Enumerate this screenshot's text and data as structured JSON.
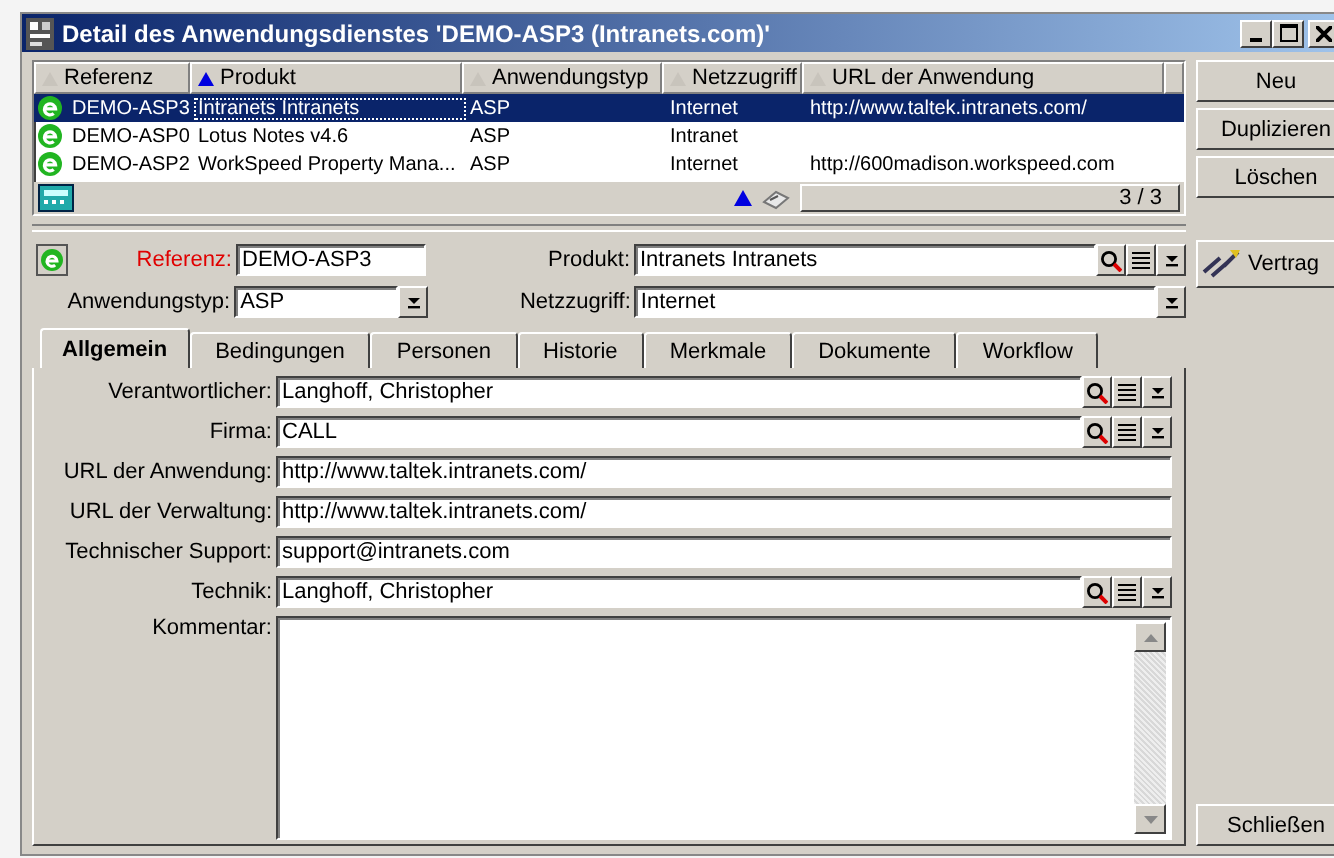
{
  "window": {
    "title": "Detail des Anwendungsdienstes 'DEMO-ASP3 (Intranets.com)'"
  },
  "list": {
    "columns": [
      {
        "label": "Referenz",
        "sorted": false
      },
      {
        "label": "Produkt",
        "sorted": true
      },
      {
        "label": "Anwendungstyp",
        "sorted": false
      },
      {
        "label": "Netzzugriff",
        "sorted": false
      },
      {
        "label": "URL der Anwendung",
        "sorted": false
      }
    ],
    "rows": [
      {
        "cells": [
          "DEMO-ASP3",
          "Intranets Intranets",
          "ASP",
          "Internet",
          "http://www.taltek.intranets.com/"
        ],
        "selected": true
      },
      {
        "cells": [
          "DEMO-ASP0",
          "Lotus Notes v4.6",
          "ASP",
          "Intranet",
          ""
        ],
        "selected": false
      },
      {
        "cells": [
          "DEMO-ASP2",
          "WorkSpeed Property Mana...",
          "ASP",
          "Internet",
          "http://600madison.workspeed.com"
        ],
        "selected": false
      }
    ],
    "counter": "3 / 3"
  },
  "side_buttons": [
    "Neu",
    "Duplizieren",
    "Löschen"
  ],
  "contract_button": "Vertrag",
  "close_button": "Schließen",
  "header": {
    "referenz": {
      "label": "Referenz:",
      "value": "DEMO-ASP3",
      "required": true
    },
    "produkt": {
      "label": "Produkt:",
      "value": "Intranets Intranets"
    },
    "typ": {
      "label": "Anwendungstyp:",
      "value": "ASP"
    },
    "netz": {
      "label": "Netzzugriff:",
      "value": "Internet"
    }
  },
  "tabs": [
    {
      "label": "Allgemein",
      "selected": true
    },
    {
      "label": "Bedingungen",
      "selected": false
    },
    {
      "label": "Personen",
      "selected": false
    },
    {
      "label": "Historie",
      "selected": false
    },
    {
      "label": "Merkmale",
      "selected": false
    },
    {
      "label": "Dokumente",
      "selected": false
    },
    {
      "label": "Workflow",
      "selected": false
    }
  ],
  "fields": [
    {
      "label": "Verantwortlicher:",
      "value": "Langhoff, Christopher",
      "kind": "lookup"
    },
    {
      "label": "Firma:",
      "value": "CALL",
      "kind": "lookup"
    },
    {
      "label": "URL der Anwendung:",
      "value": "http://www.taltek.intranets.com/",
      "kind": "text"
    },
    {
      "label": "URL der Verwaltung:",
      "value": "http://www.taltek.intranets.com/",
      "kind": "text"
    },
    {
      "label": "Technischer Support:",
      "value": "support@intranets.com",
      "kind": "text"
    },
    {
      "label": "Technik:",
      "value": "Langhoff, Christopher",
      "kind": "lookup"
    },
    {
      "label": "Kommentar:",
      "kind": "memo"
    }
  ]
}
